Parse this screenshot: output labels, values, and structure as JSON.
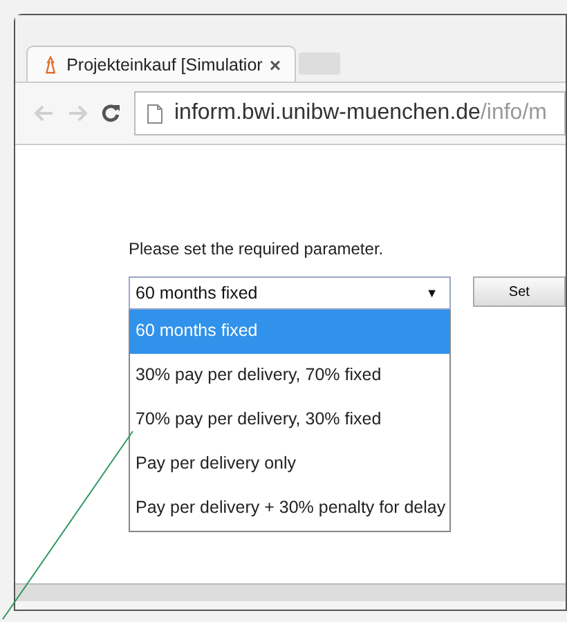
{
  "tabs": [
    {
      "kind": "page",
      "title": "Projekteinkauf [Simulatior",
      "close": "×",
      "selected": true
    },
    {
      "kind": "new",
      "selected": false
    }
  ],
  "address_bar": {
    "host": "inform.bwi.unibw-muenchen.de",
    "path": "/info/m"
  },
  "prompt": "Please set the required parameter.",
  "select": {
    "value": "60 months fixed",
    "arrow": "▼",
    "expanded": true
  },
  "set_button": "Set",
  "options": [
    {
      "label": "60 months fixed",
      "selected": true
    },
    {
      "label": "30% pay per delivery, 70% fixed",
      "selected": false
    },
    {
      "label": "70% pay per delivery, 30% fixed",
      "selected": false
    },
    {
      "label": "Pay per delivery only",
      "selected": false
    },
    {
      "label": "Pay per delivery + 30% penalty for delay",
      "selected": false
    }
  ]
}
